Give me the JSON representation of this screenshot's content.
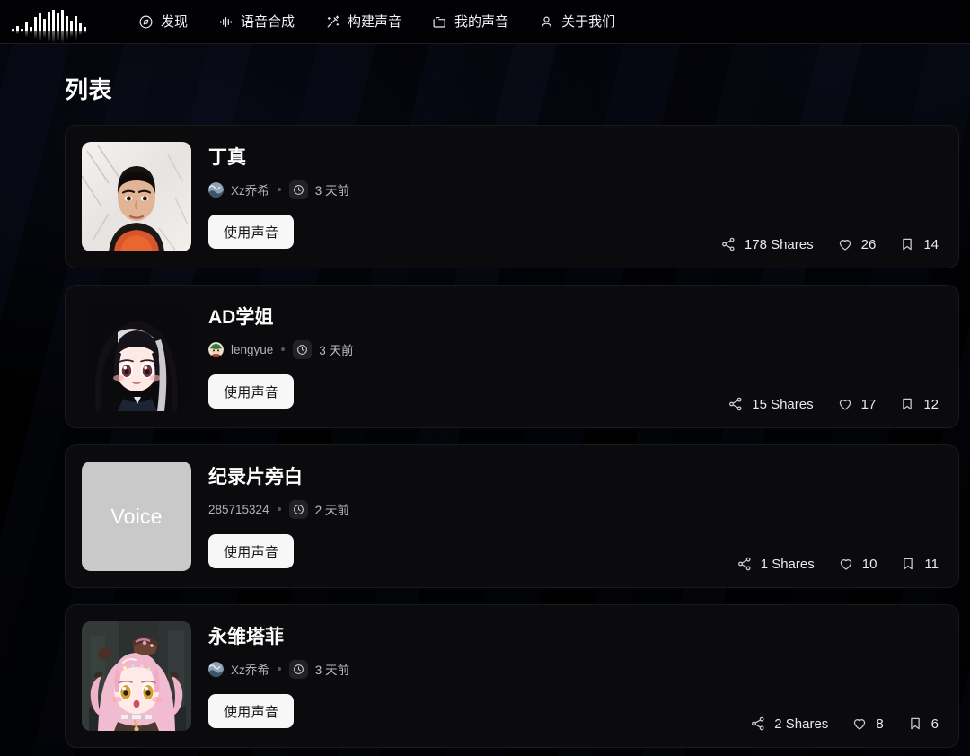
{
  "header": {
    "logo_name": "waveform-logo",
    "nav": [
      {
        "label": "发现",
        "icon": "compass-icon"
      },
      {
        "label": "语音合成",
        "icon": "audio-bars-icon"
      },
      {
        "label": "构建声音",
        "icon": "magic-wand-icon"
      },
      {
        "label": "我的声音",
        "icon": "folder-icon"
      },
      {
        "label": "关于我们",
        "icon": "user-icon"
      }
    ]
  },
  "main": {
    "page_title": "列表",
    "cards": [
      {
        "title": "丁真",
        "author": "Xz乔希",
        "has_avatar": true,
        "time": "3 天前",
        "use_label": "使用声音",
        "thumb_type": "photo-portrait",
        "placeholder_text": "",
        "shares": "178 Shares",
        "likes": "26",
        "saves": "14"
      },
      {
        "title": "AD学姐",
        "author": "lengyue",
        "has_avatar": true,
        "time": "3 天前",
        "use_label": "使用声音",
        "thumb_type": "anime-dark-hair",
        "placeholder_text": "",
        "shares": "15 Shares",
        "likes": "17",
        "saves": "12"
      },
      {
        "title": "纪录片旁白",
        "author": "285715324",
        "has_avatar": false,
        "time": "2 天前",
        "use_label": "使用声音",
        "thumb_type": "placeholder",
        "placeholder_text": "Voice",
        "shares": "1 Shares",
        "likes": "10",
        "saves": "11"
      },
      {
        "title": "永雏塔菲",
        "author": "Xz乔希",
        "has_avatar": true,
        "time": "3 天前",
        "use_label": "使用声音",
        "thumb_type": "anime-pink-hair",
        "placeholder_text": "",
        "shares": "2 Shares",
        "likes": "8",
        "saves": "6"
      }
    ],
    "stat_icons": {
      "share": "share-nodes-icon",
      "like": "heart-icon",
      "save": "bookmark-icon"
    }
  },
  "colors": {
    "background": "#010102",
    "card_bg": "#0b0b0d",
    "card_border": "#191a1e",
    "button_bg": "#f7f7f7",
    "button_text": "#17181a",
    "text_primary": "#ffffff",
    "text_muted": "#aeb1b6",
    "placeholder_thumb": "#c9c9c9"
  }
}
